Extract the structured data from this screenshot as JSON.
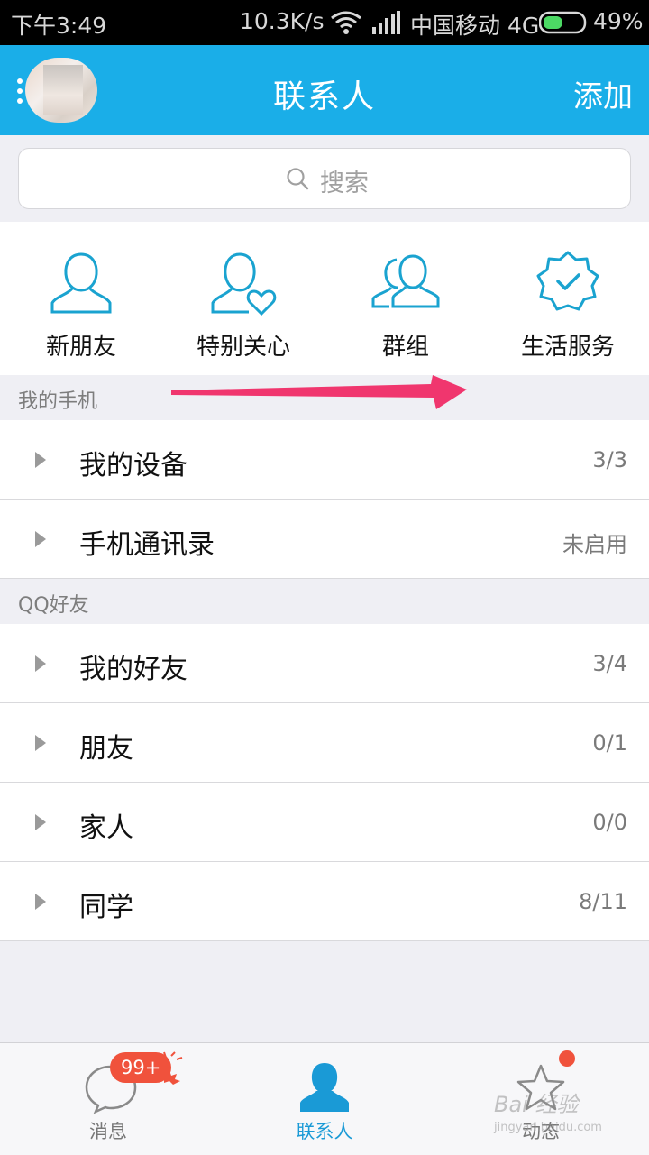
{
  "status_bar": {
    "time": "下午3:49",
    "net_speed": "10.3K/s",
    "carrier": "中国移动 4G",
    "battery": "49%",
    "battery_level": 0.49
  },
  "header": {
    "title": "联系人",
    "add_label": "添加"
  },
  "search": {
    "placeholder": "搜索"
  },
  "quick_entries": [
    {
      "label": "新朋友",
      "icon": "person-icon"
    },
    {
      "label": "特别关心",
      "icon": "person-heart-icon"
    },
    {
      "label": "群组",
      "icon": "group-icon"
    },
    {
      "label": "生活服务",
      "icon": "verified-badge-icon"
    }
  ],
  "sections": [
    {
      "title": "我的手机",
      "rows": [
        {
          "name": "我的设备",
          "count": "3/3"
        },
        {
          "name": "手机通讯录",
          "count": "未启用"
        }
      ]
    },
    {
      "title": "QQ好友",
      "rows": [
        {
          "name": "我的好友",
          "count": "3/4"
        },
        {
          "name": "朋友",
          "count": "0/1"
        },
        {
          "name": "家人",
          "count": "0/0"
        },
        {
          "name": "同学",
          "count": "8/11"
        }
      ]
    }
  ],
  "tabbar": {
    "tabs": [
      {
        "label": "消息",
        "icon": "chat-bubble-icon",
        "badge": "99+"
      },
      {
        "label": "联系人",
        "icon": "contact-person-icon",
        "active": true
      },
      {
        "label": "动态",
        "icon": "star-icon",
        "dot": true
      }
    ]
  },
  "watermark": {
    "line1": "Bai 经验",
    "line2": "jingyan.baidu.com"
  },
  "colors": {
    "accent": "#1aaee8",
    "active_tab": "#1a9ad6",
    "badge": "#f0523c",
    "annotation_arrow": "#f0366e"
  }
}
